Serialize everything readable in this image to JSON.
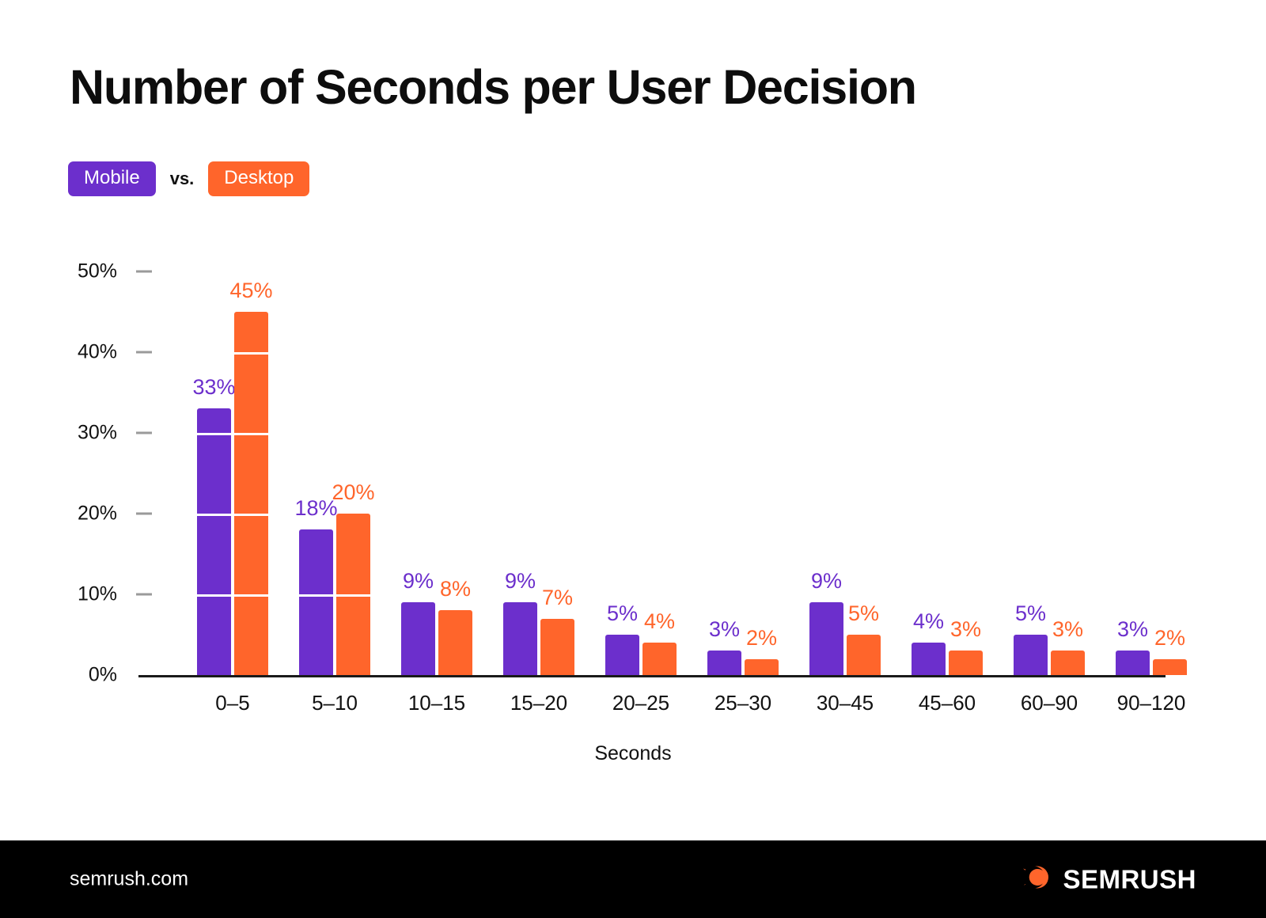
{
  "title": "Number of Seconds per User Decision",
  "legend": {
    "mobile_label": "Mobile",
    "vs_label": "vs.",
    "desktop_label": "Desktop"
  },
  "footer": {
    "url": "semrush.com",
    "brand": "SEMRUSH",
    "logo_icon": "semrush-comet-icon"
  },
  "colors": {
    "mobile": "#6C2FCC",
    "desktop": "#FF652B",
    "background": "#FFFFFF",
    "footer_background": "#000000",
    "text": "#111111",
    "gridline": "#FFFFFF",
    "axis": "#1A1A1A"
  },
  "chart_data": {
    "type": "bar",
    "title": "Number of Seconds per User Decision",
    "xlabel": "Seconds",
    "ylabel": "",
    "categories": [
      "0–5",
      "5–10",
      "10–15",
      "15–20",
      "20–25",
      "25–30",
      "30–45",
      "45–60",
      "60–90",
      "90–120"
    ],
    "series": [
      {
        "name": "Mobile",
        "color": "#6C2FCC",
        "values": [
          33,
          18,
          9,
          9,
          5,
          3,
          9,
          4,
          5,
          3
        ],
        "labels": [
          "33%",
          "18%",
          "9%",
          "9%",
          "5%",
          "3%",
          "9%",
          "4%",
          "5%",
          "3%"
        ]
      },
      {
        "name": "Desktop",
        "color": "#FF652B",
        "values": [
          45,
          20,
          8,
          7,
          4,
          2,
          5,
          3,
          3,
          2
        ],
        "labels": [
          "45%",
          "20%",
          "8%",
          "7%",
          "4%",
          "2%",
          "5%",
          "3%",
          "3%",
          "2%"
        ]
      }
    ],
    "ylim": [
      0,
      50
    ],
    "yticks": [
      0,
      10,
      20,
      30,
      40,
      50
    ],
    "ytick_labels": [
      "0%",
      "10%",
      "20%",
      "30%",
      "40%",
      "50%"
    ],
    "grid": "horizontal-over-bars-only",
    "legend_position": "top-left"
  }
}
